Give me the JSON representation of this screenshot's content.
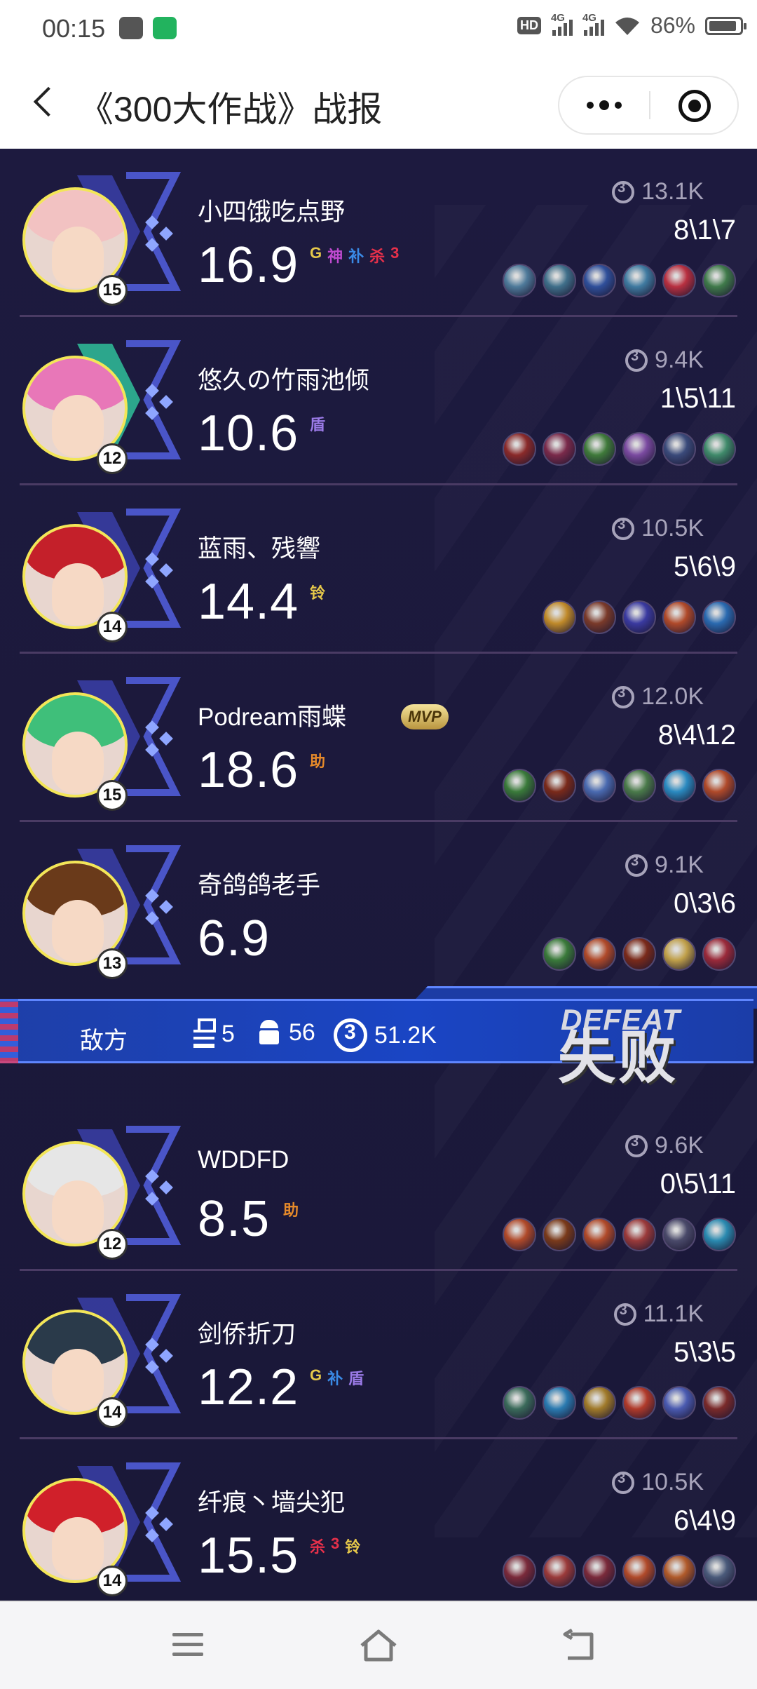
{
  "status_bar": {
    "time": "00:15",
    "network_1": "4G",
    "network_2": "4G",
    "battery": "86%",
    "hd_label": "HD",
    "icons": [
      "game-app-icon",
      "wechat-mini-icon",
      "hd-icon",
      "signal-icon",
      "signal-icon",
      "wifi-icon",
      "battery-icon"
    ]
  },
  "header": {
    "back_icon": "back-arrow-icon",
    "title": "《300大作战》战报",
    "more_icon": "more-dots-icon",
    "close_icon": "close-target-icon"
  },
  "colors": {
    "background": "#1a1838",
    "avatar_border": "#f3e657",
    "separator": "#4a3b64",
    "banner_blue": "#1a45c4",
    "muted_text": "#a7a3ba"
  },
  "ally_team": [
    {
      "name": "小四饿吃点野",
      "level": "15",
      "score": "16.9",
      "gold": "13.1K",
      "kda": "8\\1\\7",
      "badges": [
        "G",
        "神",
        "补",
        "杀",
        "3"
      ],
      "mvp": false,
      "avatar_hair": "#f2c2c2",
      "items": [
        "#4e7a9a",
        "#3f6f8a",
        "#2f4f9a",
        "#3f7aa0",
        "#b83040",
        "#3f7a4a"
      ]
    },
    {
      "name": "悠久の竹雨池倾",
      "level": "12",
      "score": "10.6",
      "gold": "9.4K",
      "kda": "1\\5\\11",
      "badges": [
        "盾"
      ],
      "mvp": false,
      "avatar_hair": "#e877b8",
      "items": [
        "#8a2a2a",
        "#7a2a4a",
        "#3f7a3a",
        "#7a4aa0",
        "#3a4a7a",
        "#3f8a6a"
      ]
    },
    {
      "name": "蓝雨、残響",
      "level": "14",
      "score": "14.4",
      "gold": "10.5K",
      "kda": "5\\6\\9",
      "badges": [
        "铃"
      ],
      "mvp": false,
      "avatar_hair": "#c4202a",
      "items": [
        "#c08a2a",
        "#7a3a2a",
        "#3a3aa0",
        "#b04a2a",
        "#2a6ab0"
      ]
    },
    {
      "name": "Podream雨蝶",
      "level": "15",
      "score": "18.6",
      "gold": "12.0K",
      "kda": "8\\4\\12",
      "badges": [
        "助"
      ],
      "mvp": true,
      "mvp_label": "MVP",
      "avatar_hair": "#3fbf7a",
      "items": [
        "#3a7a3a",
        "#7a2a1a",
        "#4a6ab0",
        "#4a7a4a",
        "#2a8ac0",
        "#b04a2a"
      ]
    },
    {
      "name": "奇鸽鸽老手",
      "level": "13",
      "score": "6.9",
      "gold": "9.1K",
      "kda": "0\\3\\6",
      "badges": [],
      "mvp": false,
      "avatar_hair": "#6a3a1a",
      "items": [
        "#3a7a3a",
        "#b04a2a",
        "#7a2a1a",
        "#c0a04a",
        "#9a2a3a"
      ]
    }
  ],
  "enemy_banner": {
    "team_label": "敌方",
    "towers": "5",
    "minions": "56",
    "gold": "51.2K",
    "result_en": "DEFEAT",
    "result_cn": "失败"
  },
  "enemy_team": [
    {
      "name": "WDDFD",
      "level": "12",
      "score": "8.5",
      "gold": "9.6K",
      "kda": "0\\5\\11",
      "badges": [
        "助"
      ],
      "mvp": false,
      "avatar_hair": "#e6e6e6",
      "items": [
        "#b04a2a",
        "#7a3a1a",
        "#b04a2a",
        "#9a3a3a",
        "#4a4a6a",
        "#2a8ab0"
      ]
    },
    {
      "name": "剑侨折刀",
      "level": "14",
      "score": "12.2",
      "gold": "11.1K",
      "kda": "5\\3\\5",
      "badges": [
        "G",
        "补",
        "盾"
      ],
      "mvp": false,
      "avatar_hair": "#2a3a4a",
      "items": [
        "#3a6a5a",
        "#2a7ab0",
        "#a07a2a",
        "#b03a2a",
        "#4a5ab0",
        "#7a2a2a"
      ]
    },
    {
      "name": "纤痕丶墙尖犯",
      "level": "14",
      "score": "15.5",
      "gold": "10.5K",
      "kda": "6\\4\\9",
      "badges": [
        "杀",
        "3",
        "铃"
      ],
      "mvp": false,
      "avatar_hair": "#d0202a",
      "items": [
        "#7a2a3a",
        "#9a3a3a",
        "#7a2a3a",
        "#b04a2a",
        "#b05a2a",
        "#4a5a7a"
      ]
    }
  ],
  "nav_bar": {
    "menu_icon": "menu-icon",
    "home_icon": "home-icon",
    "back_icon": "back-icon"
  }
}
